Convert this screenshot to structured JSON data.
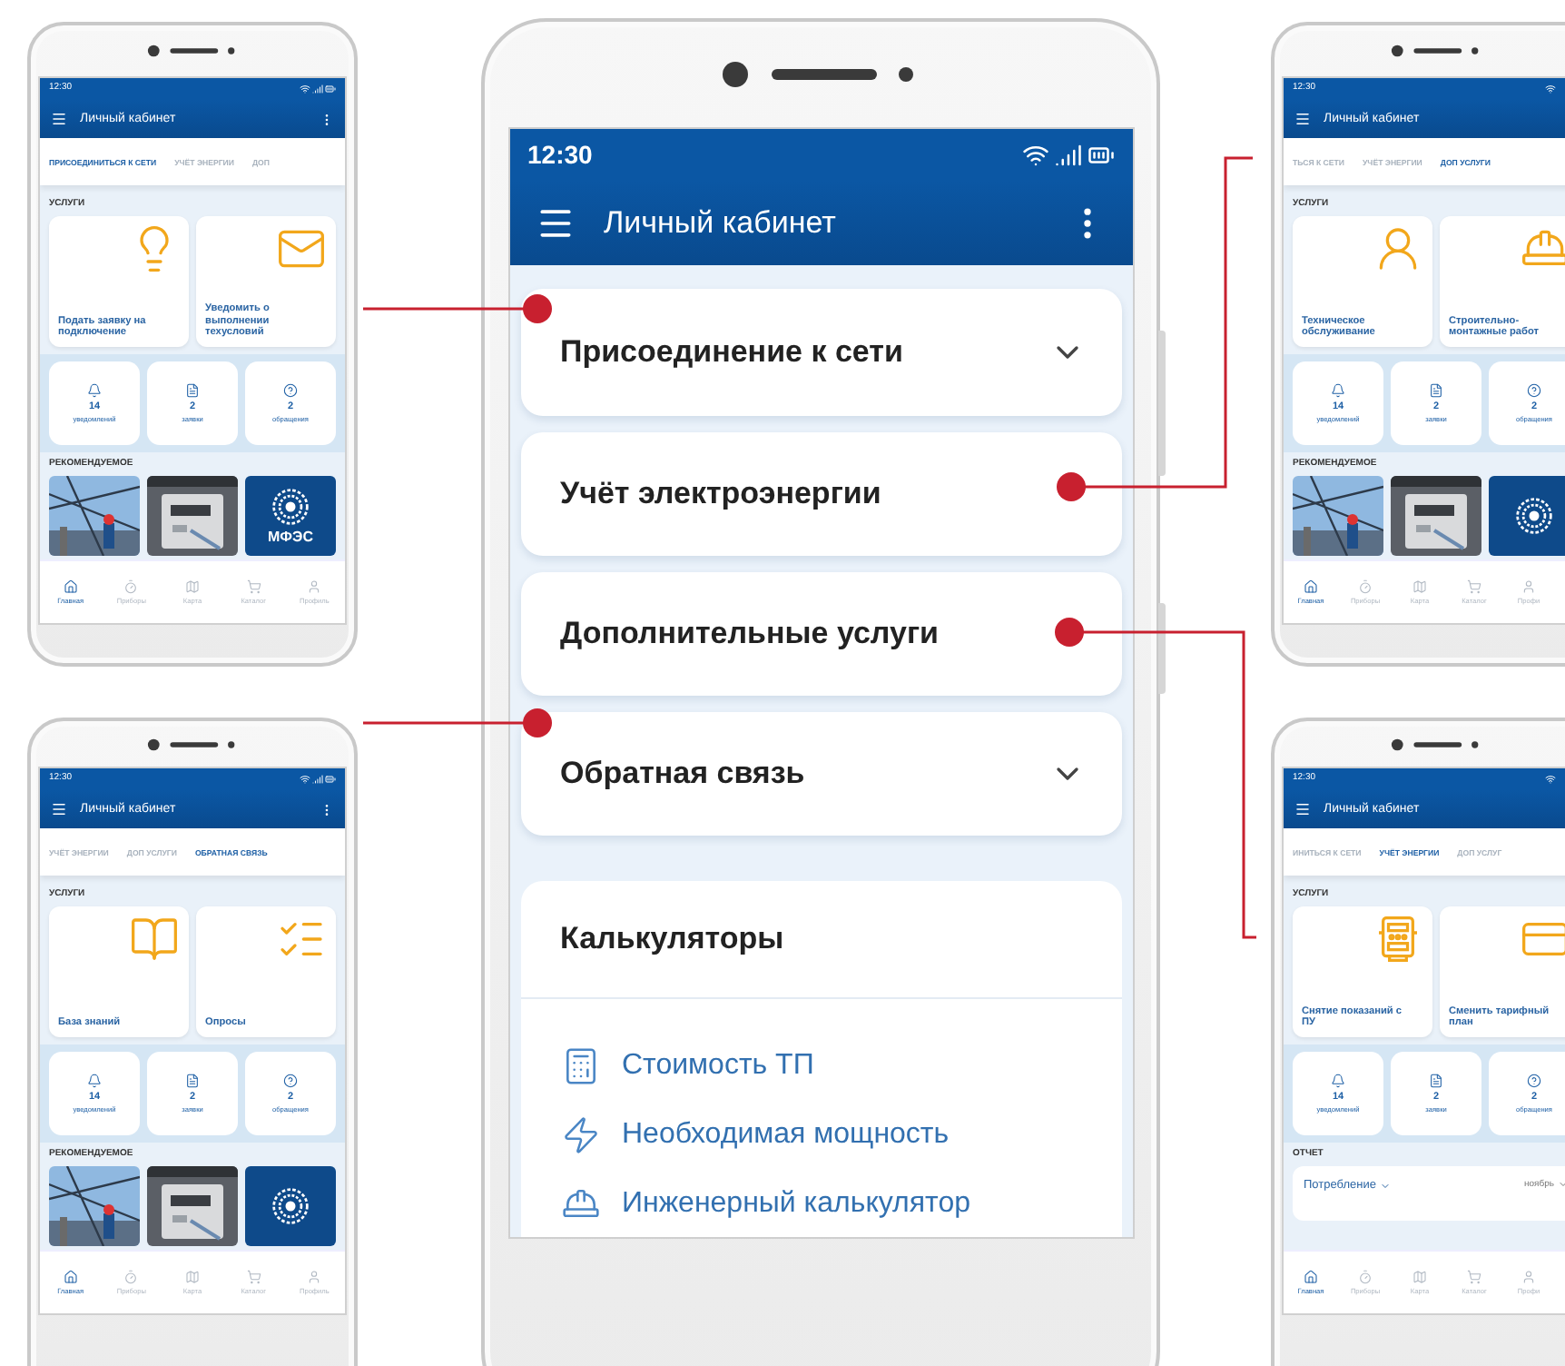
{
  "main_phone": {
    "status_time": "12:30",
    "title": "Личный кабинет",
    "sections": [
      {
        "label": "Присоединение к сети",
        "expandable": true
      },
      {
        "label": "Учёт электроэнергии"
      },
      {
        "label": "Дополнительные услуги"
      },
      {
        "label": "Обратная связь",
        "expandable": true
      }
    ],
    "calculators": {
      "title": "Калькуляторы",
      "items": [
        {
          "label": "Стоимость ТП",
          "kind": "calculator"
        },
        {
          "label": "Необходимая мощность",
          "kind": "lightning"
        },
        {
          "label": "Инженерный калькулятор",
          "kind": "helmet"
        }
      ]
    }
  },
  "side_phones": [
    {
      "status_time": "12:30",
      "title": "Личный кабинет",
      "tabs": [
        {
          "label": "ПРИСОЕДИНИТЬСЯ К СЕТИ",
          "selected": true
        },
        {
          "label": "УЧЁТ ЭНЕРГИИ",
          "selected": false
        },
        {
          "label": "ДОП",
          "selected": false
        }
      ],
      "services_title": "УСЛУГИ",
      "services": [
        {
          "label": "Подать заявку на подключение",
          "kind": "bulb"
        },
        {
          "label": "Уведомить о выполнении техусловий",
          "kind": "envelope"
        }
      ],
      "stats": [
        {
          "value": "14",
          "label": "уведомлений",
          "kind": "bell"
        },
        {
          "value": "2",
          "label": "заявки",
          "kind": "document"
        },
        {
          "value": "2",
          "label": "обращения",
          "kind": "question"
        }
      ],
      "extra": {
        "kind": "recommended",
        "title": "РЕКОМЕНДУЕМОЕ",
        "tiles": [
          {
            "kind": "picture"
          },
          {
            "kind": "picture"
          },
          {
            "kind": "logo",
            "label": "МФЭС"
          }
        ]
      },
      "nav": [
        {
          "label": "Главная",
          "kind": "home",
          "selected": true
        },
        {
          "label": "Приборы",
          "kind": "gauge",
          "selected": false
        },
        {
          "label": "Карта",
          "kind": "map",
          "selected": false
        },
        {
          "label": "Каталог",
          "kind": "cart",
          "selected": false
        },
        {
          "label": "Профиль",
          "kind": "person",
          "selected": false
        }
      ]
    },
    {
      "status_time": "12:30",
      "title": "Личный кабинет",
      "tabs": [
        {
          "label": "УЧЁТ ЭНЕРГИИ",
          "selected": false
        },
        {
          "label": "ДОП УСЛУГИ",
          "selected": false
        },
        {
          "label": "ОБРАТНАЯ СВЯЗЬ",
          "selected": true
        }
      ],
      "services_title": "УСЛУГИ",
      "services": [
        {
          "label": "База знаний",
          "kind": "book"
        },
        {
          "label": "Опросы",
          "kind": "checklist"
        }
      ],
      "stats": [
        {
          "value": "14",
          "label": "уведомлений",
          "kind": "bell"
        },
        {
          "value": "2",
          "label": "заявки",
          "kind": "document"
        },
        {
          "value": "2",
          "label": "обращения",
          "kind": "question"
        }
      ],
      "extra": {
        "kind": "recommended",
        "title": "РЕКОМЕНДУЕМОЕ",
        "tiles": [
          {
            "kind": "picture"
          },
          {
            "kind": "picture"
          },
          {
            "kind": "logo"
          }
        ]
      },
      "nav": [
        {
          "label": "Главная",
          "kind": "home",
          "selected": true
        },
        {
          "label": "Приборы",
          "kind": "gauge",
          "selected": false
        },
        {
          "label": "Карта",
          "kind": "map",
          "selected": false
        },
        {
          "label": "Каталог",
          "kind": "cart",
          "selected": false
        },
        {
          "label": "Профиль",
          "kind": "person",
          "selected": false
        }
      ]
    },
    {
      "status_time": "12:30",
      "title": "Личный кабинет",
      "tabs": [
        {
          "label": "ТЬСЯ К СЕТИ",
          "selected": false
        },
        {
          "label": "УЧЁТ ЭНЕРГИИ",
          "selected": false
        },
        {
          "label": "ДОП УСЛУГИ",
          "selected": true
        }
      ],
      "services_title": "УСЛУГИ",
      "services": [
        {
          "label": "Техническое обслуживание",
          "kind": "worker"
        },
        {
          "label": "Строительно-монтажные работ",
          "kind": "helmet"
        }
      ],
      "stats": [
        {
          "value": "14",
          "label": "уведомлений",
          "kind": "bell"
        },
        {
          "value": "2",
          "label": "заявки",
          "kind": "document"
        },
        {
          "value": "2",
          "label": "обращения",
          "kind": "question"
        }
      ],
      "extra": {
        "kind": "recommended",
        "title": "РЕКОМЕНДУЕМОЕ",
        "tiles": [
          {
            "kind": "picture"
          },
          {
            "kind": "picture"
          },
          {
            "kind": "logo"
          }
        ]
      },
      "nav": [
        {
          "label": "Главная",
          "kind": "home",
          "selected": true
        },
        {
          "label": "Приборы",
          "kind": "gauge",
          "selected": false
        },
        {
          "label": "Карта",
          "kind": "map",
          "selected": false
        },
        {
          "label": "Каталог",
          "kind": "cart",
          "selected": false
        },
        {
          "label": "Профи",
          "kind": "person",
          "selected": false
        }
      ]
    },
    {
      "status_time": "12:30",
      "title": "Личный кабинет",
      "tabs": [
        {
          "label": "ИНИТЬСЯ К СЕТИ",
          "selected": false
        },
        {
          "label": "УЧЁТ ЭНЕРГИИ",
          "selected": true
        },
        {
          "label": "ДОП УСЛУГ",
          "selected": false
        }
      ],
      "services_title": "УСЛУГИ",
      "services": [
        {
          "label": "Снятие показаний с ПУ",
          "kind": "meter"
        },
        {
          "label": "Сменить тарифный план",
          "kind": "card"
        }
      ],
      "stats": [
        {
          "value": "14",
          "label": "уведомлений",
          "kind": "bell"
        },
        {
          "value": "2",
          "label": "заявки",
          "kind": "document"
        },
        {
          "value": "2",
          "label": "обращения",
          "kind": "question"
        }
      ],
      "extra": {
        "kind": "report",
        "title": "ОТЧЕТ",
        "metric": "Потребление",
        "period": "ноябрь"
      },
      "nav": [
        {
          "label": "Главная",
          "kind": "home",
          "selected": true
        },
        {
          "label": "Приборы",
          "kind": "gauge",
          "selected": false
        },
        {
          "label": "Карта",
          "kind": "map",
          "selected": false
        },
        {
          "label": "Каталог",
          "kind": "cart",
          "selected": false
        },
        {
          "label": "Профи",
          "kind": "person",
          "selected": false
        }
      ]
    }
  ]
}
